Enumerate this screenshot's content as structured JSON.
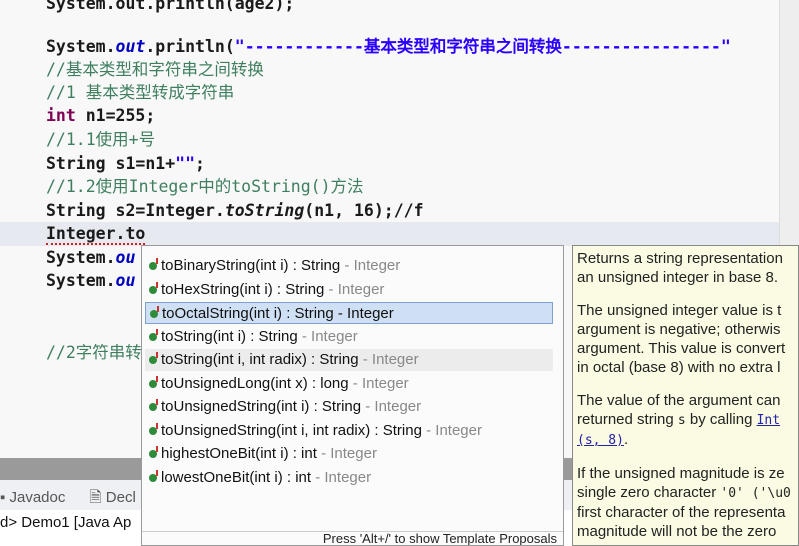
{
  "editor": {
    "line0": "System.out.println(age2);",
    "line1_a": "System.",
    "line1_b": "out",
    "line1_c": ".println(",
    "line1_d": "\"------------基本类型和字符串之间转换----------------\"",
    "line2": "//基本类型和字符串之间转换",
    "line3": "//1 基本类型转成字符串",
    "line4_kw": "int",
    "line4": " n1=255;",
    "line5": "//1.1使用+号",
    "line6_a": "String s1=n1+",
    "line6_b": "\"\"",
    "line6_c": ";",
    "line7": "//1.2使用Integer中的toString()方法",
    "line8_a": "String s2=Integer.",
    "line8_b": "toString",
    "line8_c": "(n1, 16);//f",
    "line9": "Integer.to",
    "line10_a": "System.",
    "line10_b": "ou",
    "line11_a": "System.",
    "line11_b": "ou",
    "line12": "//2字符串转"
  },
  "bottom": {
    "tab1": "Javadoc",
    "tab2": "Decl",
    "console": "d> Demo1 [Java Ap"
  },
  "popup": {
    "items": [
      {
        "name": "toBinaryString(int i) : String",
        "cls": " - Integer"
      },
      {
        "name": "toHexString(int i) : String",
        "cls": " - Integer"
      },
      {
        "name": "toOctalString(int i) : String - Integer",
        "cls": ""
      },
      {
        "name": "toString(int i) : String",
        "cls": " - Integer"
      },
      {
        "name": "toString(int i, int radix) : String",
        "cls": " - Integer"
      },
      {
        "name": "toUnsignedLong(int x) : long",
        "cls": " - Integer"
      },
      {
        "name": "toUnsignedString(int i) : String",
        "cls": " - Integer"
      },
      {
        "name": "toUnsignedString(int i, int radix) : String",
        "cls": " - Integer"
      },
      {
        "name": "highestOneBit(int i) : int",
        "cls": " - Integer"
      },
      {
        "name": "lowestOneBit(int i) : int",
        "cls": " - Integer"
      }
    ],
    "footer": "Press 'Alt+/' to show Template Proposals"
  },
  "doc": {
    "p1a": "Returns a string representation",
    "p1b": "an unsigned integer in base 8.",
    "p2a": "The unsigned integer value is t",
    "p2b": "argument is negative; otherwis",
    "p2c": "argument. This value is convert",
    "p2d": "in octal (base 8) with no extra l",
    "p3a": "The value of the argument can",
    "p3b": "returned string ",
    "p3c": "s",
    "p3d": " by calling ",
    "p3e": "Int",
    "p3f": "(s, 8)",
    "p3g": ".",
    "p4a": "If the unsigned magnitude is ze",
    "p4b": "single zero character ",
    "p4c": "'0' ('\\u0",
    "p4d": "first character of the representa",
    "p4e": "magnitude will not be the zero"
  }
}
